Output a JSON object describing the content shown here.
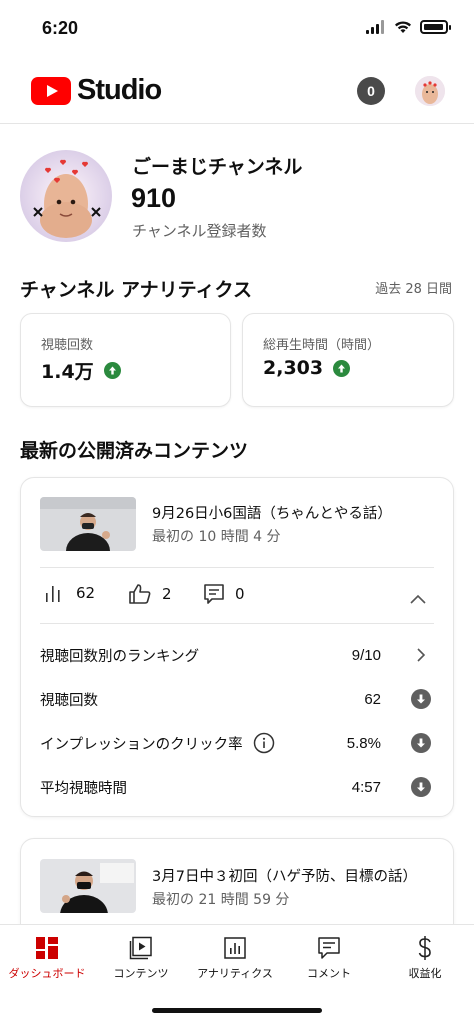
{
  "status": {
    "time": "6:20"
  },
  "header": {
    "logo_text": "Studio",
    "notification_count": "0"
  },
  "channel": {
    "name": "ごーまじチャンネル",
    "subscribers": "910",
    "subscribers_label": "チャンネル登録者数"
  },
  "analytics": {
    "title": "チャンネル アナリティクス",
    "period": "過去 28 日間",
    "metrics": [
      {
        "label": "視聴回数",
        "value": "1.4万",
        "trend": "up"
      },
      {
        "label": "総再生時間（時間）",
        "value": "2,303",
        "trend": "up"
      }
    ]
  },
  "latest": {
    "title": "最新の公開済みコンテンツ",
    "videos": [
      {
        "title": "9月26日小6国語（ちゃんとやる話）",
        "subtitle": "最初の 10 時間 4 分",
        "views": "62",
        "likes": "2",
        "comments": "0",
        "details": [
          {
            "label": "視聴回数別のランキング",
            "value": "9/10",
            "icon": "chevron-right-icon"
          },
          {
            "label": "視聴回数",
            "value": "62",
            "icon": "arrow-down-circle-icon"
          },
          {
            "label": "インプレッションのクリック率",
            "value": "5.8%",
            "icon": "arrow-down-circle-icon"
          },
          {
            "label": "平均視聴時間",
            "value": "4:57",
            "icon": "arrow-down-circle-icon"
          }
        ]
      },
      {
        "title": "3月7日中３初回（ハゲ予防、目標の話）",
        "subtitle": "最初の 21 時間 59 分"
      }
    ]
  },
  "nav": [
    {
      "label": "ダッシュボード",
      "icon": "dashboard-icon",
      "active": true
    },
    {
      "label": "コンテンツ",
      "icon": "content-icon",
      "active": false
    },
    {
      "label": "アナリティクス",
      "icon": "analytics-icon",
      "active": false
    },
    {
      "label": "コメント",
      "icon": "comment-icon",
      "active": false
    },
    {
      "label": "収益化",
      "icon": "dollar-icon",
      "active": false
    }
  ],
  "colors": {
    "brand_red": "#ff0000",
    "active_red": "#cc0000",
    "trend_green": "#2b8a3e"
  }
}
